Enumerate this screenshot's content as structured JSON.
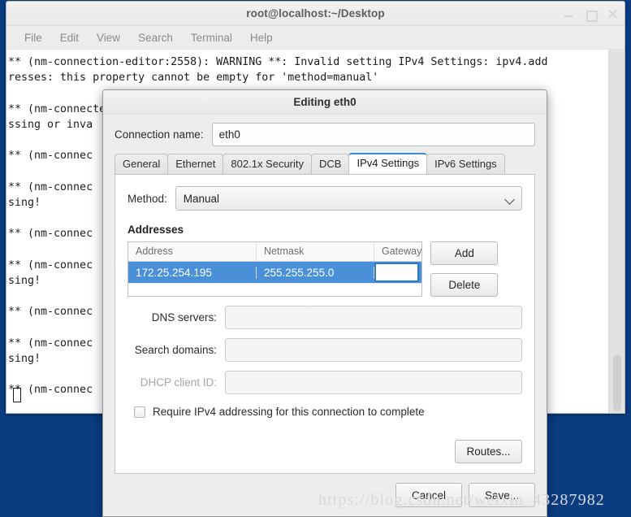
{
  "desktop": {
    "background_color": "#0a3c81"
  },
  "terminal": {
    "title": "root@localhost:~/Desktop",
    "menu": [
      "File",
      "Edit",
      "View",
      "Search",
      "Terminal",
      "Help"
    ],
    "window_buttons": [
      "minimize-icon",
      "maximize-icon",
      "close-icon"
    ],
    "output": "** (nm-connection-editor:2558): WARNING **: Invalid setting IPv4 Settings: ipv4.add\nresses: this property cannot be empty for 'method=manual'\n\n** (nm-connected                                                   none>' mi\nssing or inva\n\n** (nm-connec\n\n** (nm-connec                                                     one>' mis\nsing!\n\n** (nm-connec\n\n** (nm-connec                                                     one>' mis\nsing!\n\n** (nm-connec\n\n** (nm-connec                                                     one>' mis\nsing!\n\n** (nm-connec",
    "scrollbar": {
      "thumb_position": "near-bottom"
    }
  },
  "dialog": {
    "title": "Editing eth0",
    "connection_name": {
      "label": "Connection name:",
      "value": "eth0"
    },
    "tabs": [
      {
        "label": "General",
        "active": false
      },
      {
        "label": "Ethernet",
        "active": false
      },
      {
        "label": "802.1x Security",
        "active": false
      },
      {
        "label": "DCB",
        "active": false
      },
      {
        "label": "IPv4 Settings",
        "active": true
      },
      {
        "label": "IPv6 Settings",
        "active": false
      }
    ],
    "method": {
      "label": "Method:",
      "value": "Manual",
      "icon": "chevron-down-icon"
    },
    "addresses": {
      "heading": "Addresses",
      "columns": [
        "Address",
        "Netmask",
        "Gateway"
      ],
      "rows": [
        {
          "address": "172.25.254.195",
          "netmask": "255.255.255.0",
          "gateway": ""
        }
      ],
      "selected_row_color": "#4a90d9",
      "focus_border_color": "#2e7bc4",
      "add_label": "Add",
      "delete_label": "Delete"
    },
    "dns_servers": {
      "label": "DNS servers:",
      "value": ""
    },
    "search_domains": {
      "label": "Search domains:",
      "value": ""
    },
    "dhcp_client_id": {
      "label": "DHCP client ID:",
      "value": "",
      "disabled": true
    },
    "require_ipv4": {
      "label": "Require IPv4 addressing for this connection to complete",
      "checked": false
    },
    "routes_label": "Routes...",
    "cancel_label": "Cancel",
    "save_label": "Save..."
  },
  "watermark": {
    "text": "https://blog.csdn.net/weixin_43287982"
  }
}
